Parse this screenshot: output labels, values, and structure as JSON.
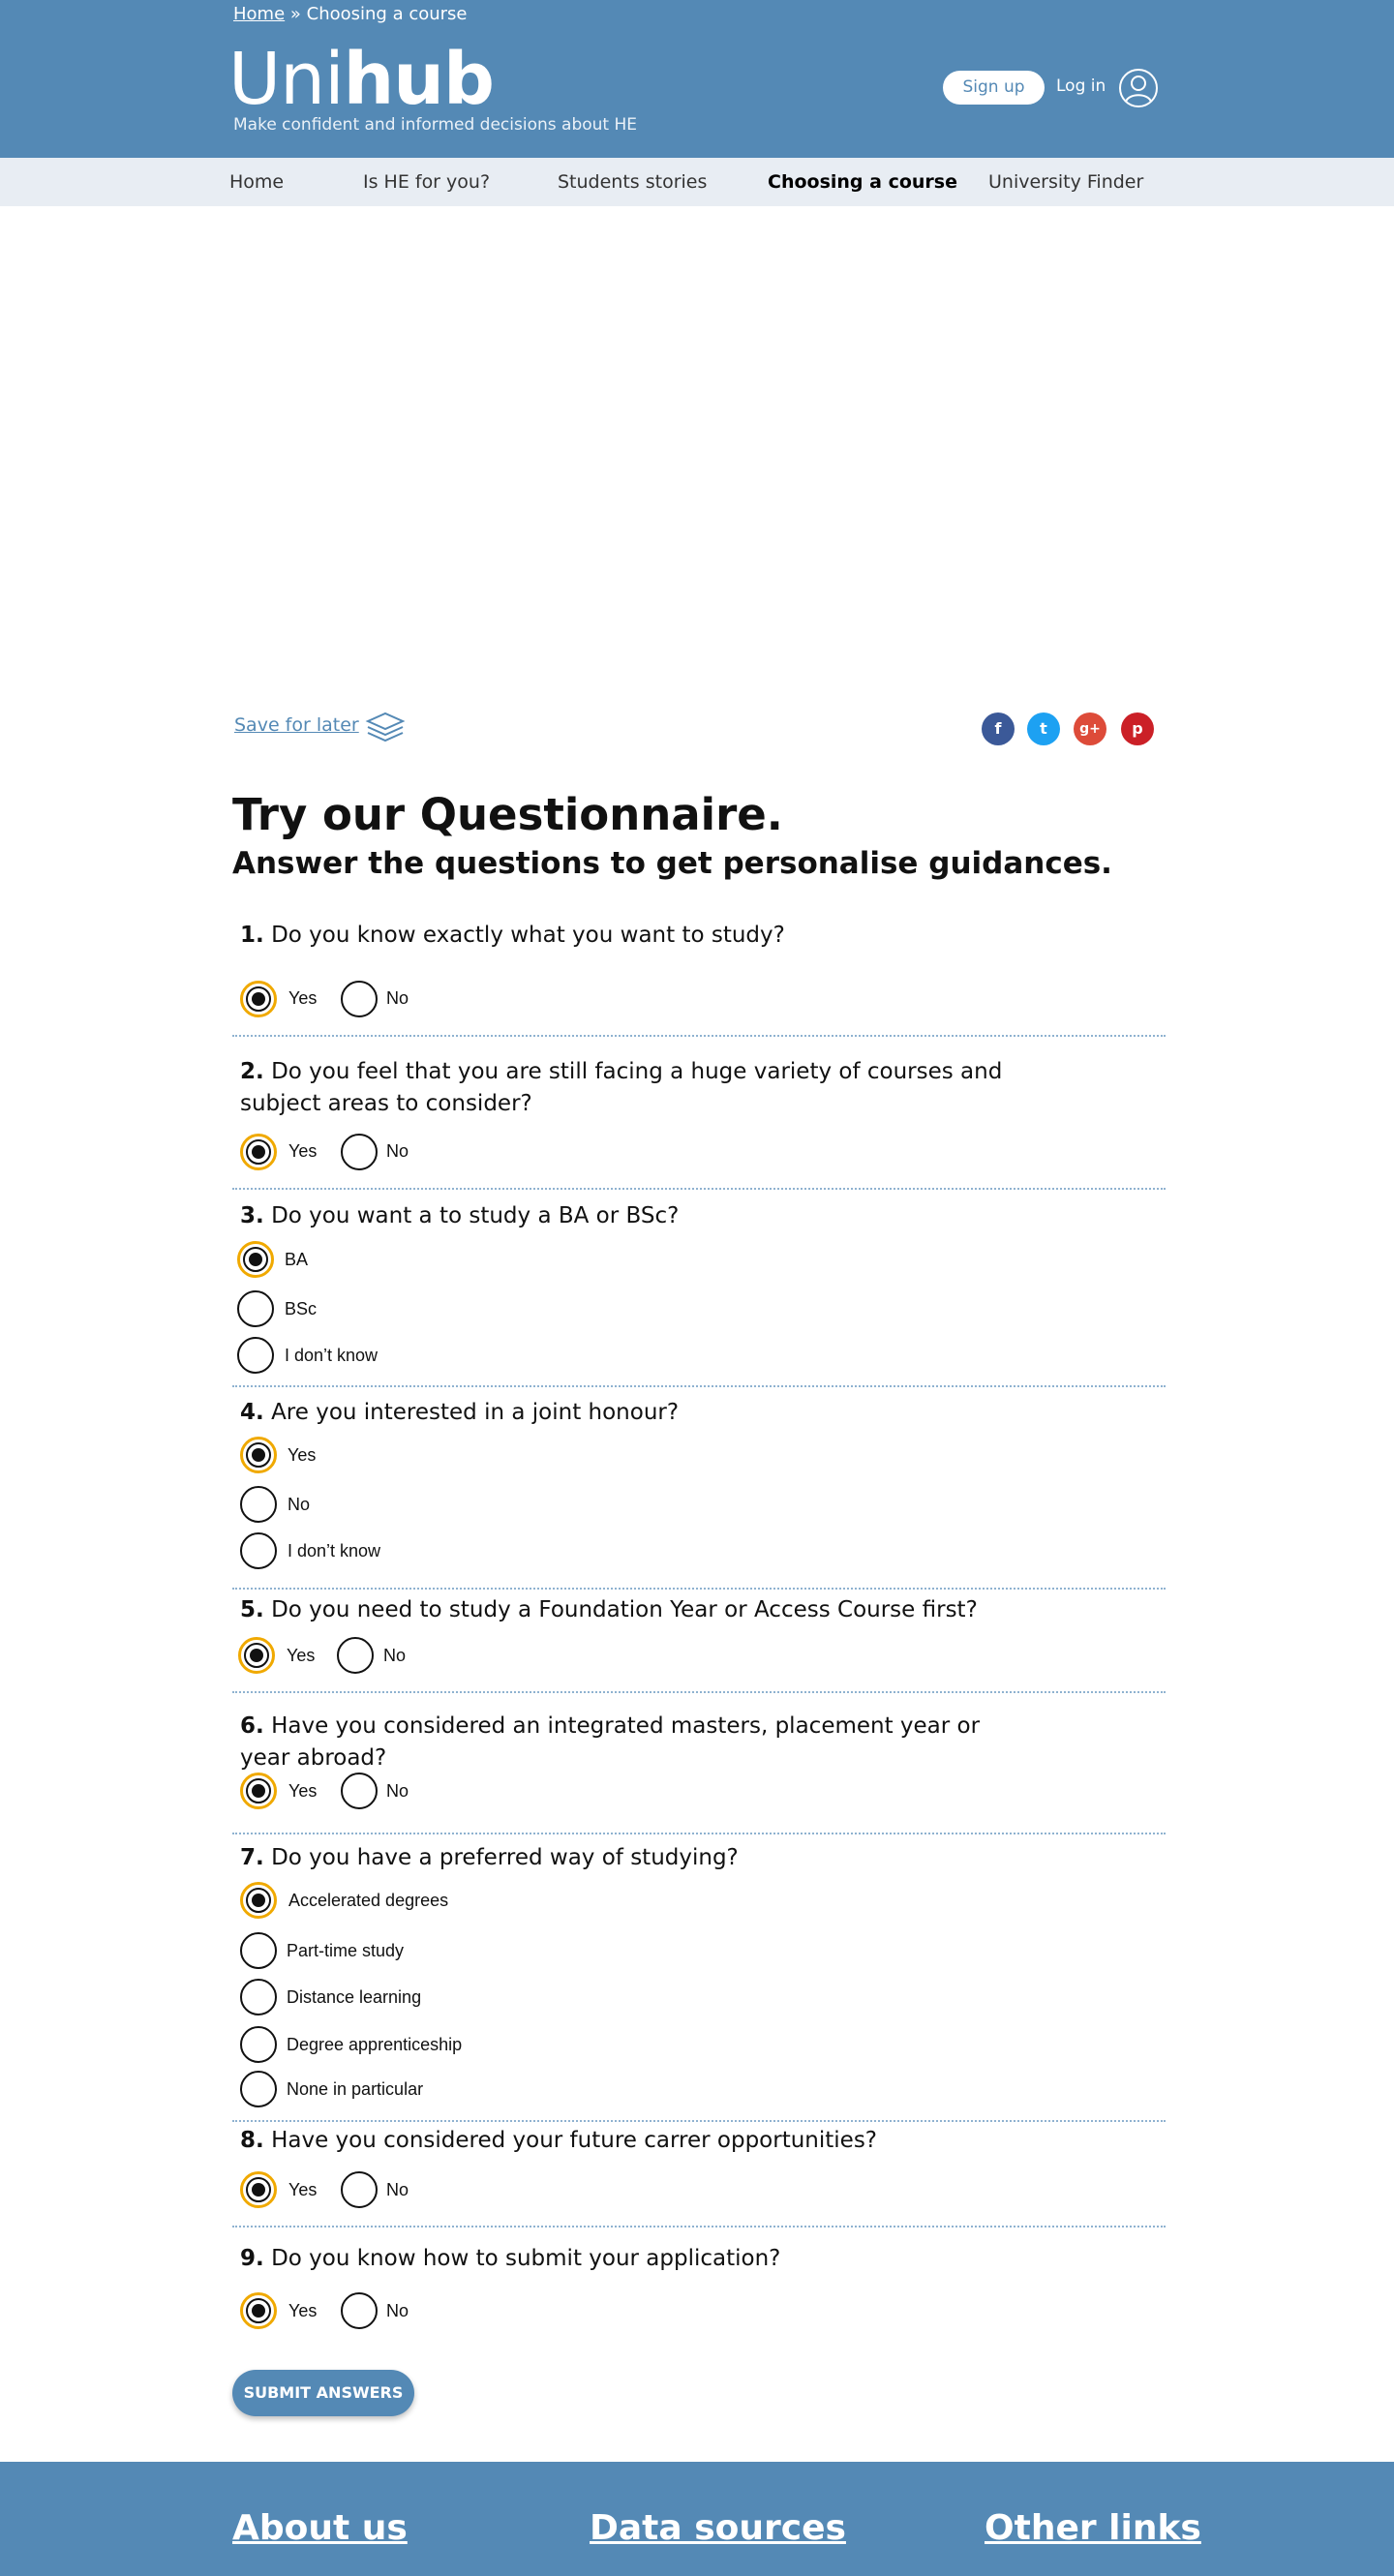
{
  "breadcrumb": {
    "home": "Home",
    "separator": "»",
    "current": "Choosing a course"
  },
  "brand": {
    "logo_light": "Uni",
    "logo_bold": "hub",
    "tagline": "Make confident and informed decisions about HE"
  },
  "account": {
    "signup": "Sign up",
    "login": "Log in"
  },
  "nav": {
    "items": [
      "Home",
      "Is HE for you?",
      "Students stories",
      "Choosing a course",
      "University Finder"
    ],
    "active": "Choosing a course"
  },
  "save": {
    "label": "Save for later"
  },
  "social": {
    "facebook": "f",
    "twitter": "t",
    "google": "g+",
    "pinterest": "p"
  },
  "heading": {
    "title": "Try our Questionnaire.",
    "subtitle": "Answer the questions to get personalise guidances."
  },
  "questions": [
    {
      "num": "1.",
      "text": "Do you know exactly what you want to study?",
      "options": [
        "Yes",
        "No"
      ],
      "selected": "Yes"
    },
    {
      "num": "2.",
      "text": "Do you feel that you are still facing a huge variety of courses and subject areas to consider?",
      "options": [
        "Yes",
        "No"
      ],
      "selected": "Yes"
    },
    {
      "num": "3.",
      "text": "Do you want a to study a BA or BSc?",
      "options": [
        "BA",
        "BSc",
        "I don’t know"
      ],
      "selected": "BA"
    },
    {
      "num": "4.",
      "text": "Are you interested in a joint honour?",
      "options": [
        "Yes",
        "No",
        "I don’t know"
      ],
      "selected": "Yes"
    },
    {
      "num": "5.",
      "text": "Do you need to study a Foundation Year or Access Course first?",
      "options": [
        "Yes",
        "No"
      ],
      "selected": "Yes"
    },
    {
      "num": "6.",
      "text": "Have you considered an integrated masters, placement year or year abroad?",
      "options": [
        "Yes",
        "No"
      ],
      "selected": "Yes"
    },
    {
      "num": "7.",
      "text": "Do you have a preferred way of studying?",
      "options": [
        "Accelerated degrees",
        "Part-time study",
        "Distance learning",
        "Degree apprenticeship",
        "None in particular"
      ],
      "selected": "Accelerated degrees"
    },
    {
      "num": "8.",
      "text": "Have you considered your future carrer opportunities?",
      "options": [
        "Yes",
        "No"
      ],
      "selected": "Yes"
    },
    {
      "num": "9.",
      "text": "Do you know how to submit your application?",
      "options": [
        "Yes",
        "No"
      ],
      "selected": "Yes"
    }
  ],
  "submit": "SUBMIT ANSWERS",
  "footer": {
    "links": [
      "About us",
      "Data sources",
      "Other links"
    ]
  },
  "colors": {
    "brand": "#5489b5",
    "nav_bg": "#e8edf3",
    "selected_ring": "#f0a900"
  }
}
